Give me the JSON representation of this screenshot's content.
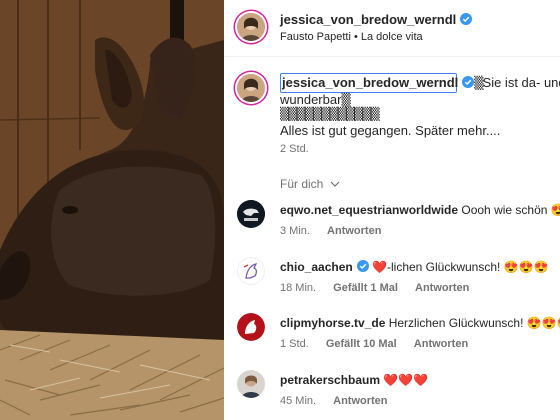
{
  "post": {
    "author": "jessica_von_bredow_werndl",
    "audio": "Fausto Papetti • La dolce vita"
  },
  "caption": {
    "author": "jessica_von_bredow_werndl",
    "line1_blocks": "▒",
    "line1_text": "Sie ist da- und e",
    "line2_text": "wunderbar",
    "line2_blocks": "▒",
    "line3_blocks": "▒▒▒▒▒▒▒▒▒▒▒▒",
    "line4_text": "Alles ist gut gegangen. Später mehr....",
    "time": "2 Std."
  },
  "filter": {
    "label": "Für dich",
    "icon": "chevron-down-icon"
  },
  "comments": [
    {
      "user": "eqwo.net_equestrianworldwide",
      "text": "Oooh wie schön",
      "emoji": "😍",
      "time": "3 Min.",
      "reply": "Antworten",
      "verified": false
    },
    {
      "user": "chio_aachen",
      "text": "❤️-lichen Glückwunsch!",
      "emoji": "😍😍😍",
      "time": "18 Min.",
      "likes": "Gefällt 1 Mal",
      "reply": "Antworten",
      "verified": true
    },
    {
      "user": "clipmyhorse.tv_de",
      "text": "Herzlichen Glückwunsch!",
      "emoji": "😍😍😍",
      "time": "1 Std.",
      "likes": "Gefällt 10 Mal",
      "reply": "Antworten",
      "verified": false
    },
    {
      "user": "petrakerschbaum",
      "text": "❤️❤️❤️",
      "time": "45 Min.",
      "reply": "Antworten",
      "verified": false
    }
  ],
  "colors": {
    "verified": "#3897f0",
    "meta": "#737373",
    "story_ring": "#d6249f"
  }
}
